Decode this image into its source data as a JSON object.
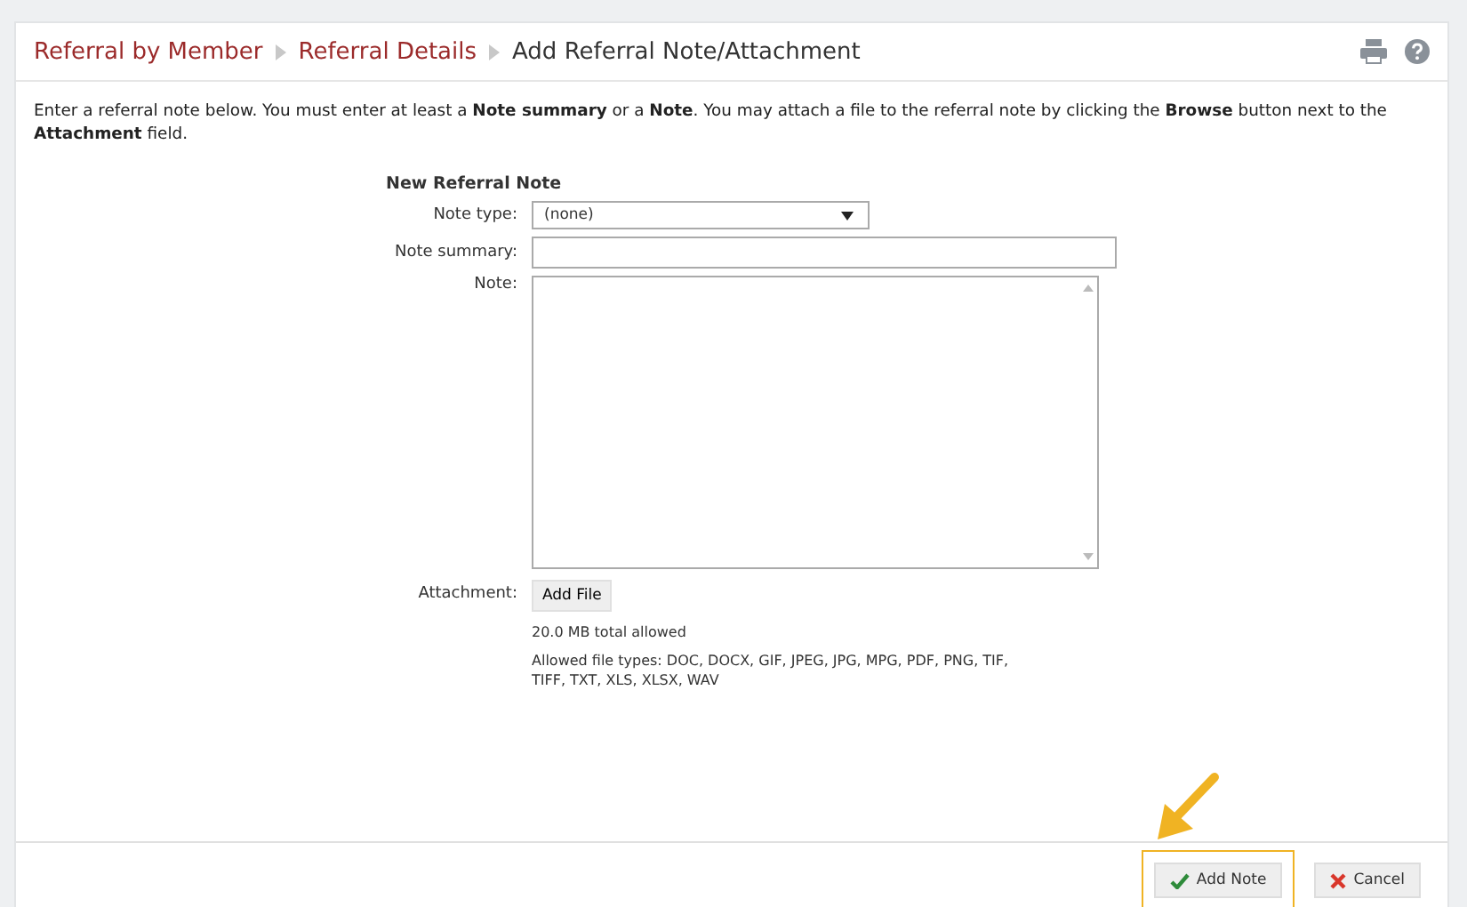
{
  "breadcrumbs": [
    {
      "label": "Referral by Member",
      "link": true
    },
    {
      "label": "Referral Details",
      "link": true
    },
    {
      "label": "Add Referral Note/Attachment",
      "link": false
    }
  ],
  "intro": "Enter a referral note below. You must enter at least a **Note summary** or a **Note**. You may attach a file to the referral note by clicking the **Browse** button next to the **Attachment** field.",
  "form": {
    "title": "New Referral Note",
    "note_type": {
      "label": "Note type:",
      "value": "(none)"
    },
    "note_summary": {
      "label": "Note summary:"
    },
    "note": {
      "label": "Note:"
    },
    "attachment": {
      "label": "Attachment:",
      "button": "Add File",
      "size_limit": "20.0 MB total allowed",
      "file_types": "Allowed file types: DOC, DOCX, GIF, JPEG, JPG, MPG, PDF, PNG, TIF, TIFF, TXT, XLS, XLSX, WAV"
    }
  },
  "buttons": [
    {
      "kind": "add",
      "label": "Add Note",
      "highlighted": true
    },
    {
      "kind": "cancel",
      "label": "Cancel",
      "highlighted": false
    }
  ]
}
